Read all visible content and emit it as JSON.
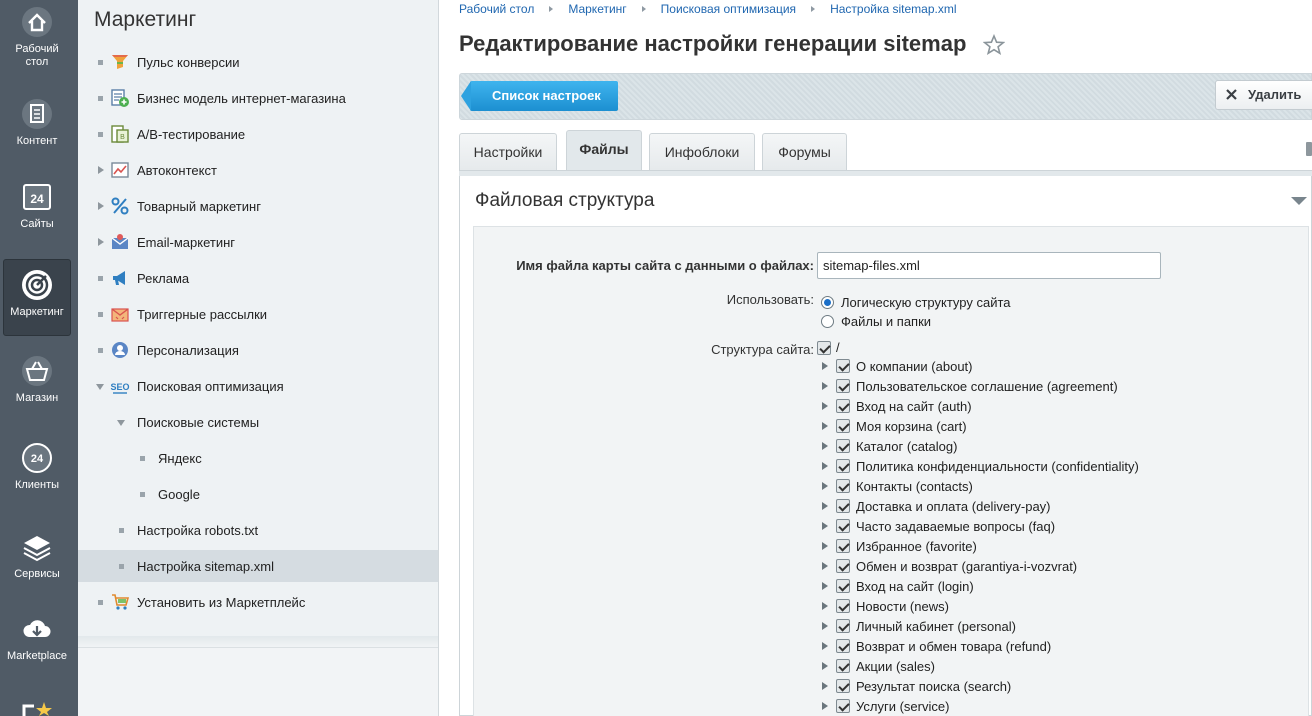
{
  "rail": [
    {
      "label": "Рабочий стол",
      "icon": "home-icon"
    },
    {
      "label": "Контент",
      "icon": "document-icon"
    },
    {
      "label": "Сайты",
      "icon": "calendar-24-icon"
    },
    {
      "label": "Маркетинг",
      "icon": "target-icon",
      "active": true
    },
    {
      "label": "Магазин",
      "icon": "basket-icon"
    },
    {
      "label": "Клиенты",
      "icon": "clients-24-icon"
    },
    {
      "label": "Сервисы",
      "icon": "layers-icon"
    },
    {
      "label": "Marketplace",
      "icon": "cloud-download-icon"
    }
  ],
  "menu": {
    "title": "Маркетинг",
    "items": [
      {
        "label": "Пульс конверсии",
        "icon": "funnel-icon"
      },
      {
        "label": "Бизнес модель интернет-магазина",
        "icon": "business-model-icon"
      },
      {
        "label": "A/B-тестирование",
        "icon": "ab-test-icon"
      },
      {
        "label": "Автоконтекст",
        "icon": "autocontext-icon"
      },
      {
        "label": "Товарный маркетинг",
        "icon": "percent-icon"
      },
      {
        "label": "Email-маркетинг",
        "icon": "email-icon"
      },
      {
        "label": "Реклама",
        "icon": "megaphone-icon"
      },
      {
        "label": "Триггерные рассылки",
        "icon": "trigger-mail-icon"
      },
      {
        "label": "Персонализация",
        "icon": "person-icon"
      },
      {
        "label": "Поисковая оптимизация",
        "icon": "seo-icon"
      },
      {
        "label": "Поисковые системы"
      },
      {
        "label": "Яндекс"
      },
      {
        "label": "Google"
      },
      {
        "label": "Настройка robots.txt"
      },
      {
        "label": "Настройка sitemap.xml",
        "selected": true
      },
      {
        "label": "Установить из Маркетплейс",
        "icon": "cart-icon"
      }
    ]
  },
  "breadcrumb": [
    "Рабочий стол",
    "Маркетинг",
    "Поисковая оптимизация",
    "Настройка sitemap.xml"
  ],
  "page_title": "Редактирование настройки генерации sitemap",
  "toolbar": {
    "list_label": "Список настроек",
    "delete_label": "Удалить"
  },
  "tabs": [
    "Настройки",
    "Файлы",
    "Инфоблоки",
    "Форумы"
  ],
  "active_tab": "Файлы",
  "section_title": "Файловая структура",
  "form": {
    "filename_label": "Имя файла карты сайта с данными о файлах:",
    "filename_value": "sitemap-files.xml",
    "use_label": "Использовать:",
    "use_options": [
      "Логическую структуру сайта",
      "Файлы и папки"
    ],
    "use_selected": "Логическую структуру сайта",
    "structure_label": "Структура сайта:",
    "root_label": "/",
    "tree": [
      "О компании (about)",
      "Пользовательское соглашение (agreement)",
      "Вход на сайт (auth)",
      "Моя корзина (cart)",
      "Каталог (catalog)",
      "Политика конфиденциальности (confidentiality)",
      "Контакты (contacts)",
      "Доставка и оплата (delivery-pay)",
      "Часто задаваемые вопросы (faq)",
      "Избранное (favorite)",
      "Обмен и возврат (garantiya-i-vozvrat)",
      "Вход на сайт (login)",
      "Новости (news)",
      "Личный кабинет (personal)",
      "Возврат и обмен товара (refund)",
      "Акции (sales)",
      "Результат поиска (search)",
      "Услуги (service)"
    ]
  },
  "colors": {
    "rail_bg": "#505b66",
    "accent_blue": "#2067b0",
    "button_blue": "#1c8fd1"
  }
}
